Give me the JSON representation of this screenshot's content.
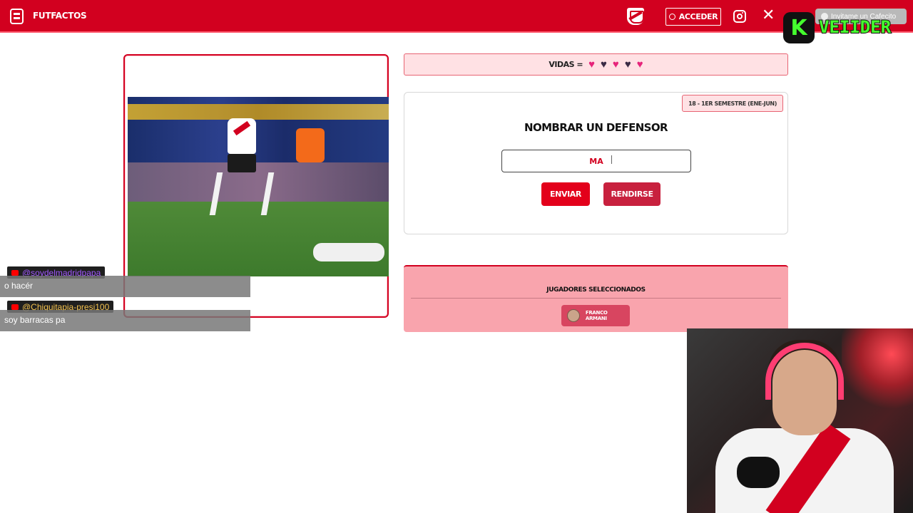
{
  "header": {
    "brand": "FUTFACTOS",
    "login_label": "ACCEDER",
    "donate_label": "Invitame un Cafecito",
    "icons": [
      "app-logo-icon",
      "club-crest-icon",
      "lock-icon",
      "instagram-icon",
      "x-icon",
      "coffee-icon"
    ]
  },
  "overlay": {
    "badge_letter": "K",
    "streamer_name": "VEIIDER"
  },
  "lives": {
    "label": "VIDAS =",
    "hearts": [
      "full",
      "empty",
      "full",
      "empty",
      "full"
    ],
    "colors": {
      "full": "#e6247a",
      "empty": "#3a2b45"
    }
  },
  "question": {
    "season": "18 - 1ER SEMESTRE (ENE-JUN)",
    "title": "NOMBRAR UN DEFENSOR",
    "answer_value": "MA",
    "submit_label": "ENVIAR",
    "giveup_label": "RENDIRSE"
  },
  "selected": {
    "title": "JUGADORES SELECCIONADOS",
    "players": [
      {
        "name": "FRANCO ARMANI"
      }
    ]
  },
  "chat": [
    {
      "user": "@soydelmadridpapa",
      "message": "o hacér",
      "user_color": "#a259ff"
    },
    {
      "user": "@Chiquitapia-presi100",
      "message": "soy barracas pa",
      "user_color": "#f2c14e"
    }
  ],
  "theme": {
    "primary": "#d2001f",
    "accent_bg": "#ffe1e4",
    "selected_bg": "#f9a4ad"
  }
}
